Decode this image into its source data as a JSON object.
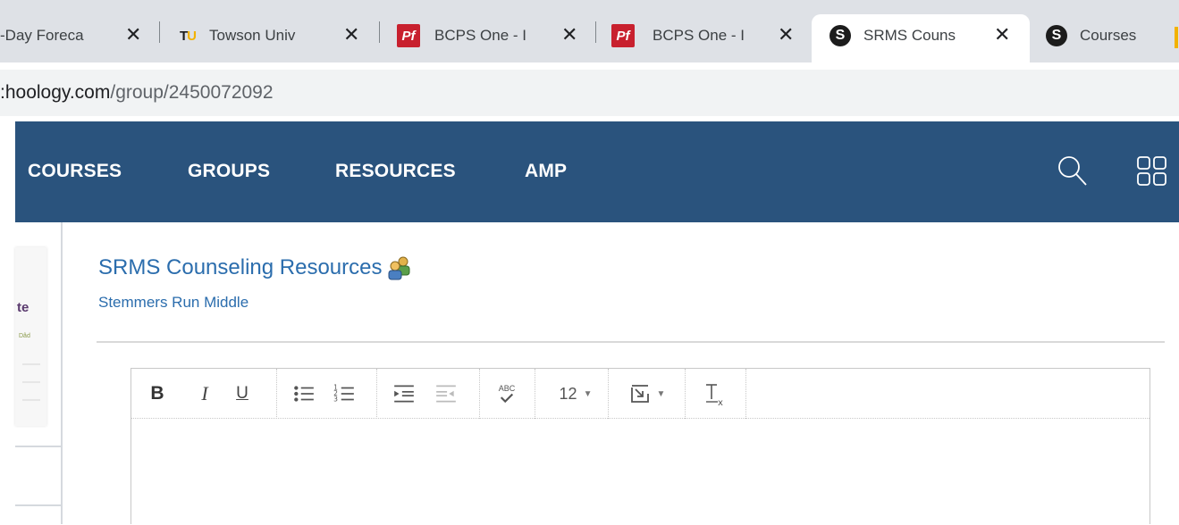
{
  "browser": {
    "tabs": [
      {
        "title": "-Day Foreca",
        "favicon": "none",
        "active": false
      },
      {
        "title": "Towson Univ",
        "favicon": "tu-logo-icon",
        "active": false
      },
      {
        "title": "BCPS One - I",
        "favicon": "pf-icon",
        "active": false
      },
      {
        "title": "BCPS One - I",
        "favicon": "pf-icon",
        "active": false
      },
      {
        "title": "SRMS Couns",
        "favicon": "schoology-s-icon",
        "active": true
      },
      {
        "title": "Courses",
        "favicon": "schoology-s-icon",
        "active": false
      }
    ],
    "favicon_labels": {
      "tu_t": "T",
      "tu_u": "U",
      "pf": "Pf",
      "schoology": "S"
    },
    "close_glyph": "✕",
    "url_host": ":hoology.com",
    "url_path": "/group/2450072092"
  },
  "nav": {
    "items": [
      "COURSES",
      "GROUPS",
      "RESOURCES",
      "AMP"
    ],
    "bg_color": "#2a537d"
  },
  "sidebar": {
    "fragment_text": "te",
    "fragment_small": "Dâd"
  },
  "group": {
    "title": "SRMS Counseling Resources",
    "school": "Stemmers Run Middle",
    "link_color": "#2b6dad"
  },
  "editor": {
    "toolbar": {
      "bold": "B",
      "italic": "I",
      "underline": "U",
      "font_size": "12",
      "spellcheck_label": "ABC"
    }
  }
}
